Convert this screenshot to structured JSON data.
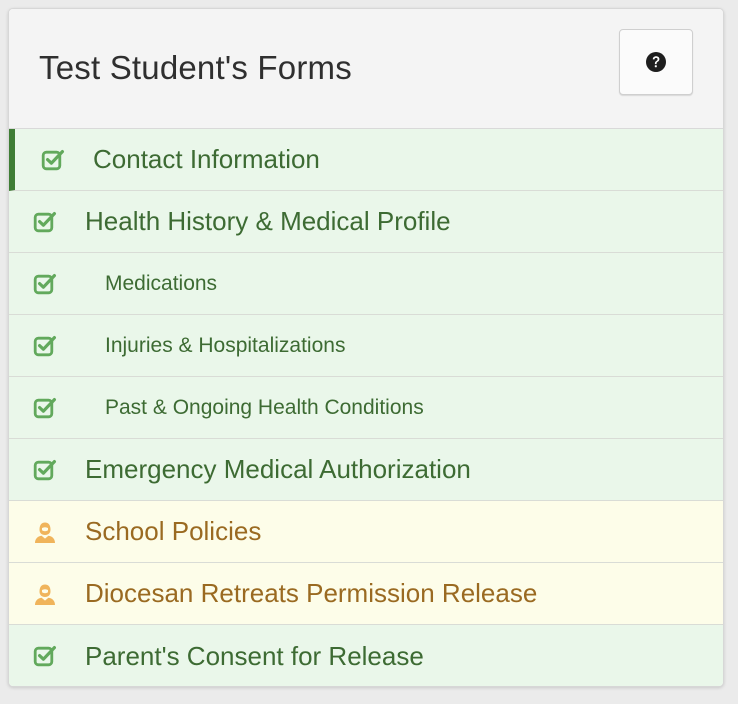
{
  "header": {
    "title": "Test Student's Forms",
    "help_icon": "question-circle-icon"
  },
  "colors": {
    "complete_text": "#3d6b33",
    "complete_background": "#eaf7ea",
    "complete_icon": "#62a95c",
    "pending_text": "#9a6a21",
    "pending_background": "#fdfde9",
    "pending_icon": "#f0b45b",
    "active_marker": "#3f7d35"
  },
  "forms": [
    {
      "label": "Contact Information",
      "status": "complete",
      "icon": "checked-box-icon",
      "active": true,
      "sub": false
    },
    {
      "label": "Health History & Medical Profile",
      "status": "complete",
      "icon": "checked-box-icon",
      "active": false,
      "sub": false
    },
    {
      "label": "Medications",
      "status": "complete",
      "icon": "checked-box-icon",
      "active": false,
      "sub": true
    },
    {
      "label": "Injuries & Hospitalizations",
      "status": "complete",
      "icon": "checked-box-icon",
      "active": false,
      "sub": true
    },
    {
      "label": "Past & Ongoing Health Conditions",
      "status": "complete",
      "icon": "checked-box-icon",
      "active": false,
      "sub": true
    },
    {
      "label": "Emergency Medical Authorization",
      "status": "complete",
      "icon": "checked-box-icon",
      "active": false,
      "sub": false
    },
    {
      "label": "School Policies",
      "status": "pending",
      "icon": "parent-user-icon",
      "active": false,
      "sub": false
    },
    {
      "label": "Diocesan Retreats Permission Release",
      "status": "pending",
      "icon": "parent-user-icon",
      "active": false,
      "sub": false
    },
    {
      "label": "Parent's Consent for Release",
      "status": "complete",
      "icon": "checked-box-icon",
      "active": false,
      "sub": false
    }
  ]
}
